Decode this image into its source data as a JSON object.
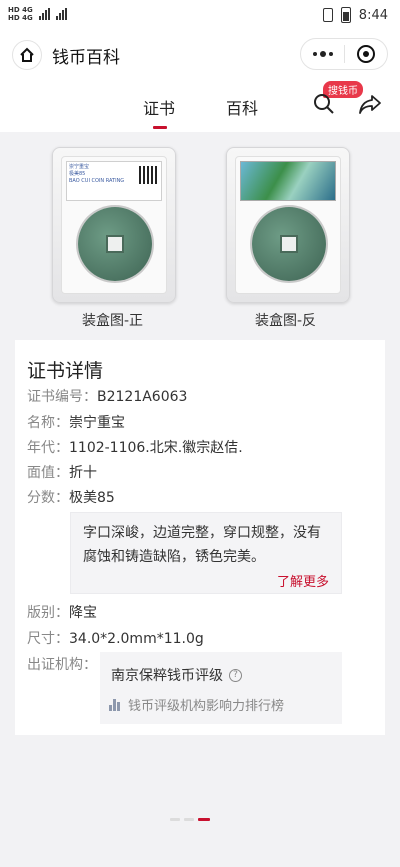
{
  "status_bar": {
    "network_1": "HD 4G",
    "network_2": "HD 4G",
    "time": "8:44"
  },
  "nav": {
    "title": "钱币百科"
  },
  "tabs": [
    {
      "label": "证书",
      "active": true
    },
    {
      "label": "百科",
      "active": false
    }
  ],
  "badge": "搜钱币",
  "photos": {
    "front_caption": "装盒图-正",
    "back_caption": "装盒图-反",
    "front_label_lines": [
      "崇宁重宝",
      "极美85",
      "BAO CUI COIN RATING"
    ]
  },
  "details": {
    "title": "证书详情",
    "rows": [
      {
        "label": "证书编号：",
        "value": "B2121A6063"
      },
      {
        "label": "名称：",
        "value": "崇宁重宝"
      },
      {
        "label": "年代：",
        "value": "1102-1106.北宋.徽宗赵佶."
      },
      {
        "label": "面值：",
        "value": "折十"
      },
      {
        "label": "分数：",
        "value": "极美85"
      }
    ],
    "grade_comment": "字口深峻，边道完整，穿口规整，没有腐蚀和铸造缺陷，锈色完美。",
    "more_link": "了解更多",
    "rows2": [
      {
        "label": "版别：",
        "value": "降宝"
      },
      {
        "label": "尺寸：",
        "value": "34.0*2.0mm*11.0g"
      }
    ],
    "issuer_label": "出证机构：",
    "issuer_name": "南京保粹钱币评级",
    "issuer_rank": "钱币评级机构影响力排行榜"
  },
  "colors": {
    "accent": "#c8102e",
    "badge": "#e8384a"
  },
  "pager": {
    "total": 3,
    "active_index": 2
  }
}
